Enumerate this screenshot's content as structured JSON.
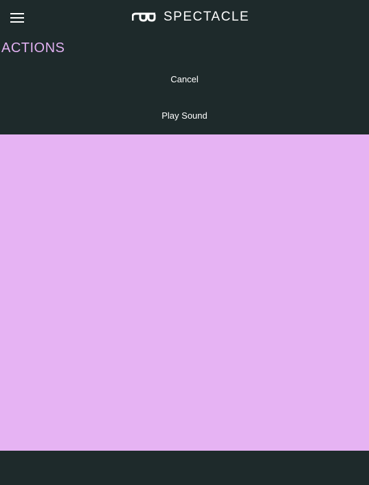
{
  "header": {
    "app_name": "SPECTACLE",
    "menu_icon": "hamburger-icon",
    "logo_icon": "glasses-icon"
  },
  "section": {
    "title": "ACTIONS"
  },
  "actions": [
    {
      "label": "Cancel"
    },
    {
      "label": "Play Sound"
    }
  ],
  "canvas": {
    "color": "#e6b3f3"
  }
}
